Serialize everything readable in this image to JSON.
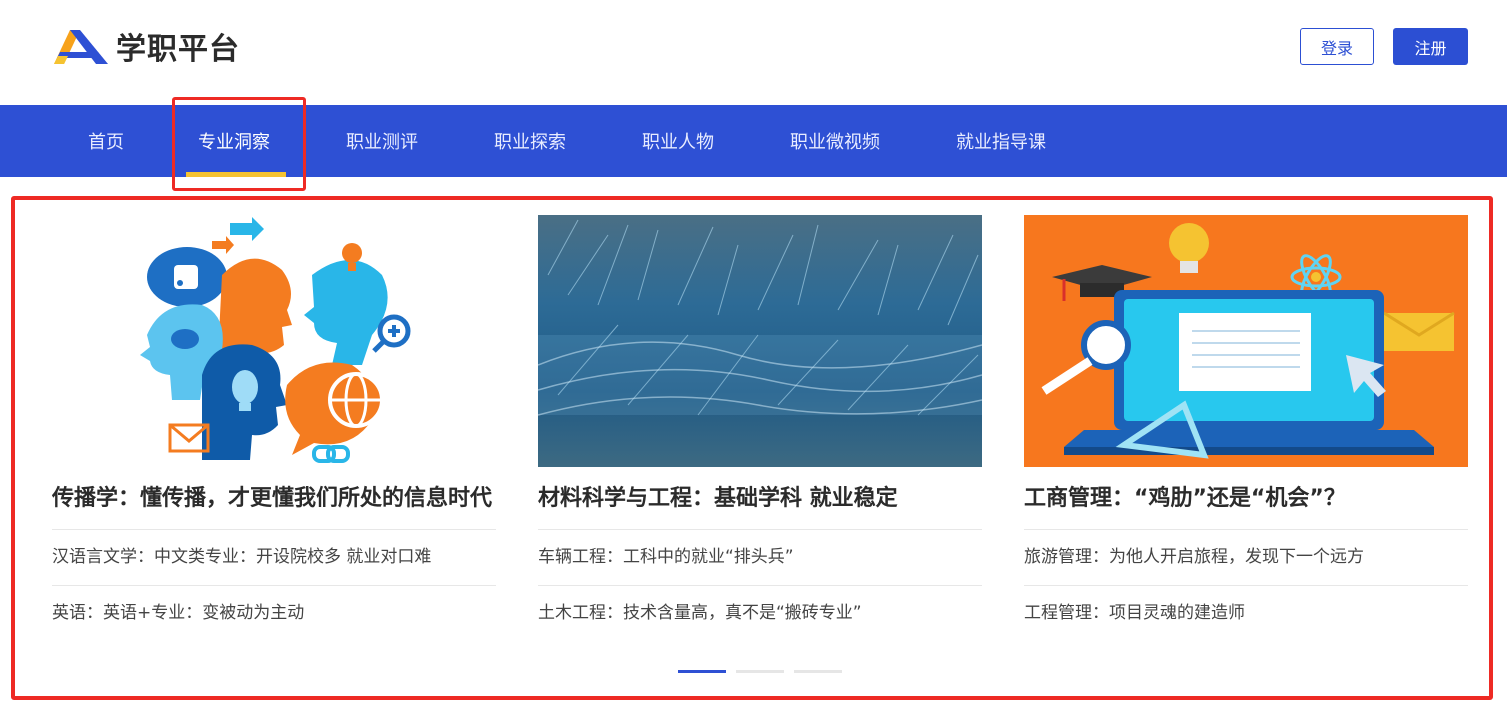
{
  "header": {
    "logo_text": "学职平台",
    "login_label": "登录",
    "register_label": "注册"
  },
  "nav": {
    "items": [
      {
        "label": "首页"
      },
      {
        "label": "专业洞察",
        "active": true
      },
      {
        "label": "职业测评"
      },
      {
        "label": "职业探索"
      },
      {
        "label": "职业人物"
      },
      {
        "label": "职业微视频"
      },
      {
        "label": "就业指导课"
      }
    ]
  },
  "cards": [
    {
      "image": "communication-heads-illustration",
      "title": "传播学：懂传播，才更懂我们所处的信息时代",
      "links": [
        "汉语言文学：中文类专业：开设院校多 就业对口难",
        "英语：英语+专业：变被动为主动"
      ]
    },
    {
      "image": "blue-fiber-material-photo",
      "title": "材料科学与工程：基础学科 就业稳定",
      "links": [
        "车辆工程：工科中的就业“排头兵”",
        "土木工程：技术含量高，真不是“搬砖专业”"
      ]
    },
    {
      "image": "laptop-education-illustration",
      "title": "工商管理：“鸡肋”还是“机会”？",
      "links": [
        "旅游管理：为他人开启旅程，发现下一个远方",
        "工程管理：项目灵魂的建造师"
      ]
    }
  ],
  "pager": {
    "total": 3,
    "current": 1
  },
  "colors": {
    "brand": "#2e50d4",
    "accent": "#f5c331",
    "annotation": "#ee2a24"
  }
}
